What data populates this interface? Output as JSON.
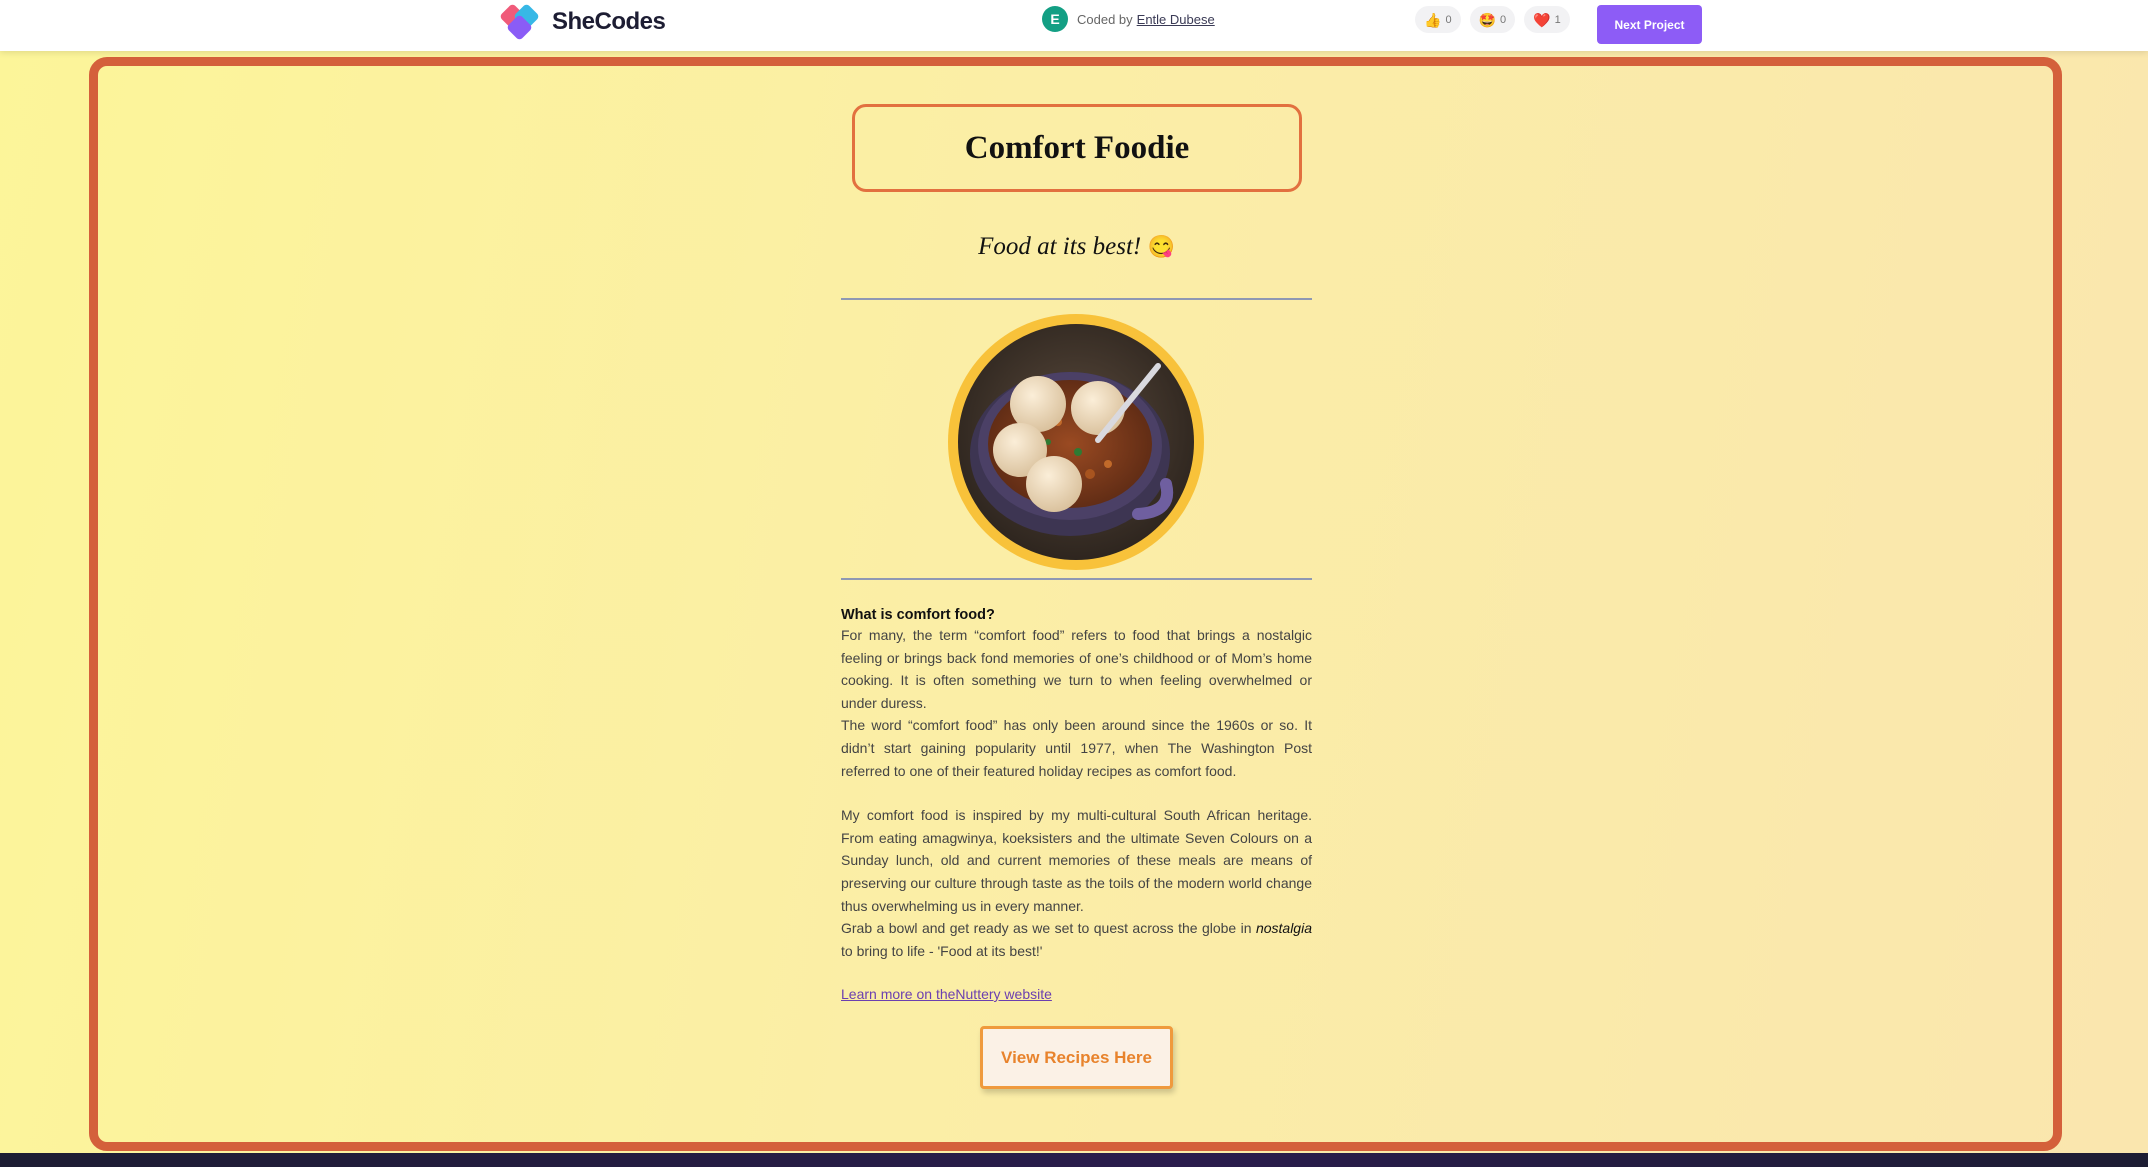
{
  "header": {
    "logo_text": "SheCodes",
    "avatar_initial": "E",
    "coded_by": "Coded by",
    "author": "Entle Dubese",
    "reactions": [
      {
        "icon": "thumbs-up-icon",
        "emoji": "👍",
        "count": "0"
      },
      {
        "icon": "star-struck-icon",
        "emoji": "🤩",
        "count": "0"
      },
      {
        "icon": "heart-icon",
        "emoji": "❤️",
        "count": "1"
      }
    ],
    "next_label": "Next Project"
  },
  "page": {
    "title": "Comfort Foodie",
    "tagline": "Food at its best!",
    "tagline_emoji": "😋",
    "image_alt": "Pot of stew with dumplings",
    "section_heading": "What is comfort food?",
    "para1": "For many, the term “comfort food” refers to food that brings a nostalgic feeling or brings back fond memories of one’s childhood or of Mom’s home cooking. It is often something we turn to when feeling overwhelmed or under duress.",
    "para2": "The word “comfort food” has only been around since the 1960s or so. It didn’t start gaining popularity until 1977, when The Washington Post referred to one of their featured holiday recipes as comfort food.",
    "para3": "My comfort food is inspired by my multi-cultural South African heritage. From eating amagwinya, koeksisters and the ultimate Seven Colours on a Sunday lunch, old and current memories of these meals are means of preserving our culture through taste as the toils of the modern world change thus overwhelming us in every manner.",
    "para4_before": "Grab a bowl and get ready as we set to quest across the globe in ",
    "para4_em": "nostalgia",
    "para4_after": " to bring to life - 'Food at its best!'",
    "learn_link": "Learn more on theNuttery website",
    "recipes_button": "View Recipes Here"
  },
  "colors": {
    "frame": "#d4603b",
    "accent_purple": "#8d5cf6",
    "button_orange": "#ef9a3d",
    "image_ring": "#f8c23a"
  }
}
